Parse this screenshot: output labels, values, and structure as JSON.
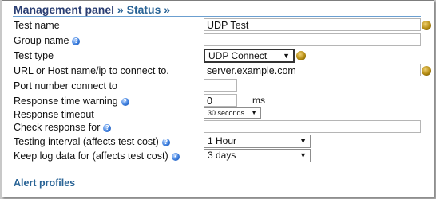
{
  "header": {
    "root": "Management panel",
    "sep1": "»",
    "current": "Status",
    "sep2": "»"
  },
  "fields": {
    "test_name": {
      "label": "Test name",
      "value": "UDP Test"
    },
    "group_name": {
      "label": "Group name"
    },
    "test_type": {
      "label": "Test type",
      "value": "UDP Connect"
    },
    "host": {
      "label": "URL or Host name/ip to connect to.",
      "value": "server.example.com"
    },
    "port": {
      "label": "Port number connect to",
      "value": ""
    },
    "response_warning": {
      "label": "Response time warning",
      "value": "0",
      "unit": "ms"
    },
    "response_timeout": {
      "label": "Response timeout",
      "value": "30 seconds"
    },
    "check_response": {
      "label": "Check response for",
      "value": ""
    },
    "testing_interval": {
      "label": "Testing interval (affects test cost)",
      "value": "1 Hour"
    },
    "keep_log": {
      "label": "Keep log data for (affects test cost)",
      "value": "3 days"
    }
  },
  "alert_profiles": {
    "title": "Alert profiles"
  },
  "icons": {
    "help": "help-icon",
    "status": "status-ball-icon",
    "dropdown": "dropdown-arrow-icon"
  }
}
